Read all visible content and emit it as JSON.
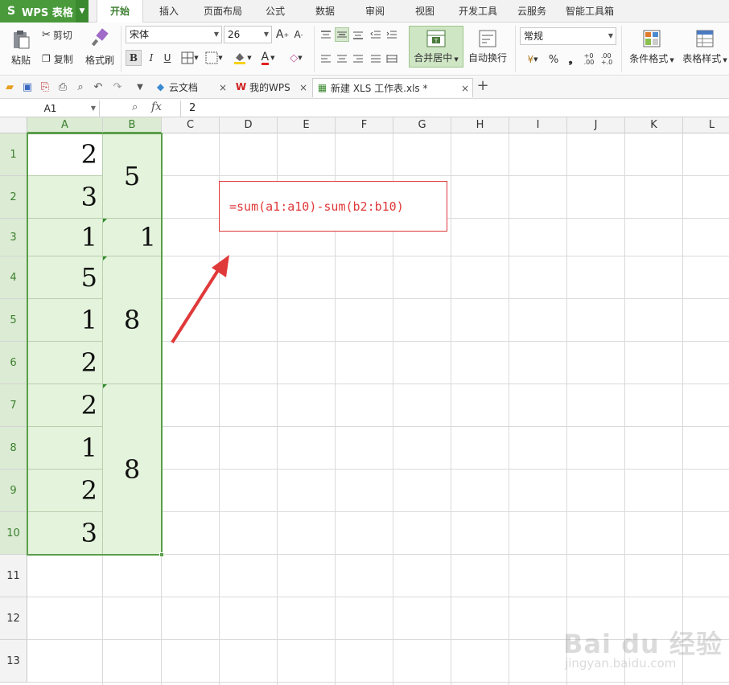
{
  "app": {
    "name": "WPS 表格",
    "logo_glyph": "S"
  },
  "menu": {
    "tabs": [
      {
        "label": "开始",
        "active": true
      },
      {
        "label": "插入"
      },
      {
        "label": "页面布局"
      },
      {
        "label": "公式"
      },
      {
        "label": "数据"
      },
      {
        "label": "审阅"
      },
      {
        "label": "视图"
      },
      {
        "label": "开发工具"
      },
      {
        "label": "云服务"
      },
      {
        "label": "智能工具箱"
      }
    ]
  },
  "ribbon": {
    "paste": "粘贴",
    "cut": "剪切",
    "copy": "复制",
    "format_painter": "格式刷",
    "font_name": "宋体",
    "font_size": "26",
    "bold": "B",
    "italic": "I",
    "underline": "U",
    "merge_center": "合并居中",
    "wrap_text": "自动换行",
    "number_format": "常规",
    "percent": "%",
    "comma": "❟",
    "cond_format": "条件格式",
    "table_style": "表格样式"
  },
  "doc_tabs": [
    {
      "label": "云文档"
    },
    {
      "label": "我的WPS"
    },
    {
      "label": "新建 XLS 工作表.xls *",
      "active": true
    }
  ],
  "formula_bar": {
    "name_box": "A1",
    "fx": "fx",
    "content": "2"
  },
  "sheet": {
    "columns": [
      "A",
      "B",
      "C",
      "D",
      "E",
      "F",
      "G",
      "H",
      "I",
      "J",
      "K",
      "L"
    ],
    "rows": [
      "1",
      "2",
      "3",
      "4",
      "5",
      "6",
      "7",
      "8",
      "9",
      "10",
      "11",
      "12",
      "13"
    ],
    "col_a_values": [
      "2",
      "3",
      "1",
      "5",
      "1",
      "2",
      "2",
      "1",
      "2",
      "3"
    ],
    "col_b_merged": [
      {
        "value": "5",
        "rows": "1-2"
      },
      {
        "value": "1",
        "rows": "3"
      },
      {
        "value": "8",
        "rows": "4-6"
      },
      {
        "value": "8",
        "rows": "7-10"
      }
    ]
  },
  "annotation": {
    "formula": "=sum(a1:a10)-sum(b2:b10)",
    "color": "#e0393a"
  },
  "watermark": {
    "brand": "Bai du 经验",
    "url": "jingyan.baidu.com"
  },
  "colors": {
    "accent": "#4a9a3c",
    "selection_fill": "#e4f3dc",
    "annotation_red": "#e0393a"
  }
}
